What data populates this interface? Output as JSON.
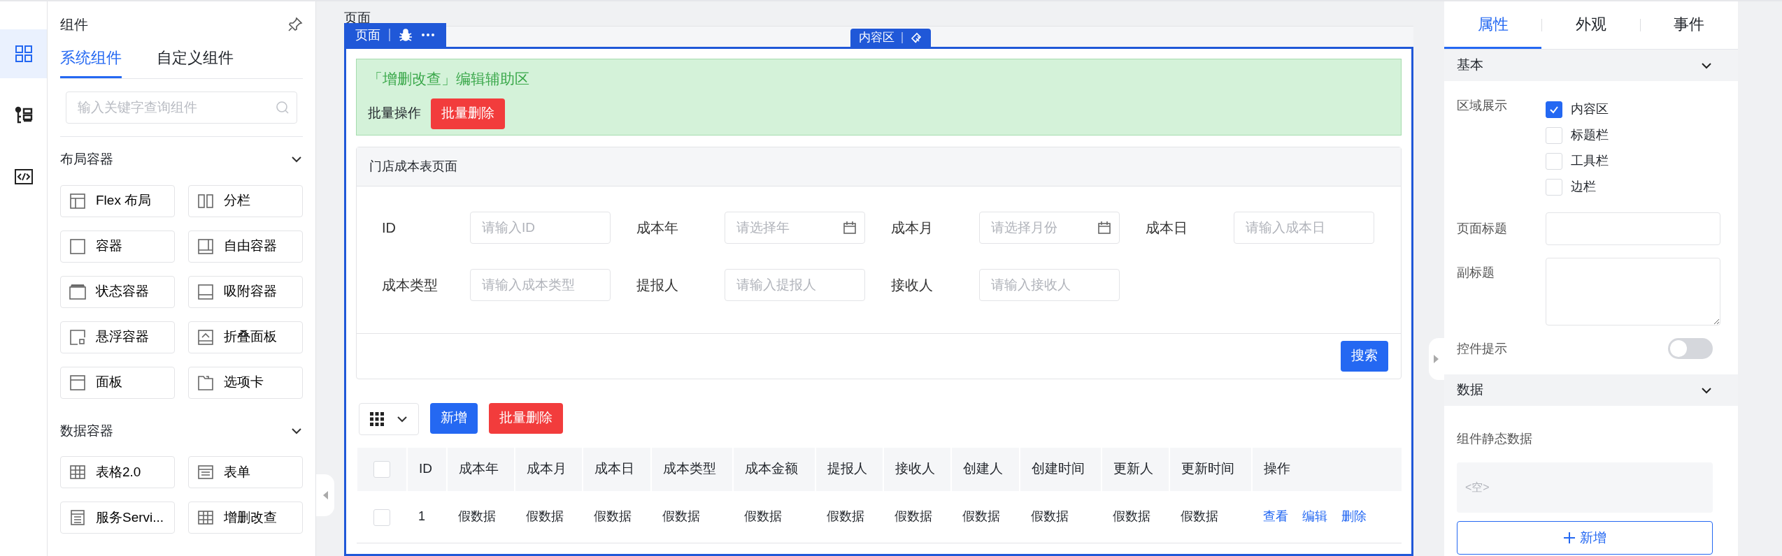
{
  "rail": {
    "items": [
      {
        "kind": "components",
        "selected": true
      },
      {
        "kind": "outline",
        "selected": false
      },
      {
        "kind": "code",
        "selected": false
      }
    ]
  },
  "component_panel": {
    "title": "组件",
    "tabs": [
      {
        "label": "系统组件",
        "selected": true
      },
      {
        "label": "自定义组件",
        "selected": false
      }
    ],
    "search": {
      "placeholder": "输入关键字查询组件"
    },
    "groups": [
      {
        "title": "布局容器",
        "expanded": true,
        "items": [
          {
            "label": "Flex 布局",
            "kind": "flex"
          },
          {
            "label": "分栏",
            "kind": "columns"
          },
          {
            "label": "容器",
            "kind": "container"
          },
          {
            "label": "自由容器",
            "kind": "free"
          },
          {
            "label": "状态容器",
            "kind": "state"
          },
          {
            "label": "吸附容器",
            "kind": "sticky"
          },
          {
            "label": "悬浮容器",
            "kind": "float"
          },
          {
            "label": "折叠面板",
            "kind": "collapse"
          },
          {
            "label": "面板",
            "kind": "panel"
          },
          {
            "label": "选项卡",
            "kind": "tabs"
          }
        ]
      },
      {
        "title": "数据容器",
        "expanded": true,
        "items": [
          {
            "label": "表格2.0",
            "kind": "table"
          },
          {
            "label": "表单",
            "kind": "form"
          },
          {
            "label": "服务Servi...",
            "kind": "service"
          },
          {
            "label": "增删改查",
            "kind": "table"
          }
        ]
      }
    ]
  },
  "canvas": {
    "page_label": "页面",
    "page_tag": "页面",
    "content_tag": "内容区",
    "helper": {
      "title": "「增删改查」编辑辅助区",
      "batch_label": "批量操作",
      "batch_button": "批量删除"
    },
    "form": {
      "title": "门店成本表页面",
      "fields": [
        {
          "label": "ID",
          "placeholder": "请输入ID",
          "kind": "text"
        },
        {
          "label": "成本年",
          "placeholder": "请选择年",
          "kind": "date"
        },
        {
          "label": "成本月",
          "placeholder": "请选择月份",
          "kind": "date"
        },
        {
          "label": "成本日",
          "placeholder": "请输入成本日",
          "kind": "text"
        },
        {
          "label": "成本类型",
          "placeholder": "请输入成本类型",
          "kind": "text"
        },
        {
          "label": "提报人",
          "placeholder": "请输入提报人",
          "kind": "text"
        },
        {
          "label": "接收人",
          "placeholder": "请输入接收人",
          "kind": "text"
        }
      ],
      "submit": "搜索"
    },
    "toolbar": {
      "buttons": [
        {
          "label": "新增",
          "kind": "primary"
        },
        {
          "label": "批量删除",
          "kind": "danger"
        }
      ]
    },
    "table": {
      "all_checked": false,
      "columns": [
        "ID",
        "成本年",
        "成本月",
        "成本日",
        "成本类型",
        "成本金额",
        "提报人",
        "接收人",
        "创建人",
        "创建时间",
        "更新人",
        "更新时间",
        "操作"
      ],
      "rows": [
        {
          "checked": false,
          "cells": [
            "1",
            "假数据",
            "假数据",
            "假数据",
            "假数据",
            "假数据",
            "假数据",
            "假数据",
            "假数据",
            "假数据",
            "假数据",
            "假数据"
          ],
          "actions": [
            "查看",
            "编辑",
            "删除"
          ]
        }
      ]
    }
  },
  "props_panel": {
    "tabs": [
      {
        "label": "属性",
        "selected": true
      },
      {
        "label": "外观",
        "selected": false
      },
      {
        "label": "事件",
        "selected": false
      }
    ],
    "basic": {
      "title": "基本",
      "expanded": true,
      "area_label": "区域展示",
      "areas": [
        {
          "label": "内容区",
          "checked": true
        },
        {
          "label": "标题栏",
          "checked": false
        },
        {
          "label": "工具栏",
          "checked": false
        },
        {
          "label": "边栏",
          "checked": false
        }
      ],
      "page_title_label": "页面标题",
      "subtitle_label": "副标题",
      "hint_label": "控件提示",
      "hint_on": false
    },
    "data": {
      "title": "数据",
      "expanded": true,
      "static_label": "组件静态数据",
      "empty_text": "<空>",
      "add_button": "新增"
    }
  }
}
